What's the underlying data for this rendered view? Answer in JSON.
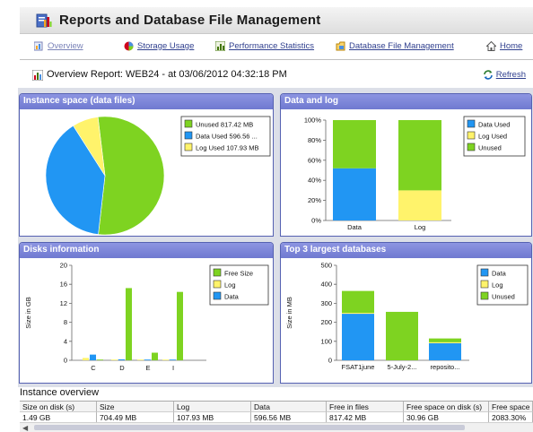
{
  "window": {
    "title": "Reports and Database File Management"
  },
  "nav": {
    "items": [
      {
        "label": "Overview",
        "icon": "overview-icon",
        "active": true
      },
      {
        "label": "Storage Usage",
        "icon": "storage-icon"
      },
      {
        "label": "Performance Statistics",
        "icon": "performance-icon"
      },
      {
        "label": "Database File Management",
        "icon": "database-file-icon"
      },
      {
        "label": "Home",
        "icon": "home-icon"
      }
    ]
  },
  "report": {
    "title": "Overview Report: WEB24 - at 03/06/2012 04:32:18 PM",
    "refresh_label": "Refresh"
  },
  "colors": {
    "green": "#7ed321",
    "blue": "#2196f3",
    "yellow": "#fff36b",
    "header": "#7982d6"
  },
  "panels": {
    "instance_space": {
      "title": "Instance space (data files)"
    },
    "data_and_log": {
      "title": "Data and log"
    },
    "disks": {
      "title": "Disks information"
    },
    "top3": {
      "title": "Top 3 largest databases"
    }
  },
  "chart_data": [
    {
      "type": "pie",
      "title": "Instance space (data files)",
      "labels": [
        "Unused 817.42 MB",
        "Data Used 596.56 ...",
        "Log Used 107.93 MB"
      ],
      "values": [
        817.42,
        596.56,
        107.93
      ],
      "colors": [
        "#7ed321",
        "#2196f3",
        "#fff36b"
      ],
      "legend": "top-right"
    },
    {
      "type": "bar",
      "stacked": true,
      "title": "Data and log",
      "categories": [
        "Data",
        "Log"
      ],
      "series": [
        {
          "name": "Data Used",
          "values": [
            52,
            0
          ],
          "color": "#2196f3"
        },
        {
          "name": "Log Used",
          "values": [
            0,
            30
          ],
          "color": "#fff36b"
        },
        {
          "name": "Unused",
          "values": [
            48,
            70
          ],
          "color": "#7ed321"
        }
      ],
      "yticks": [
        "0%",
        "20%",
        "40%",
        "60%",
        "80%",
        "100%"
      ],
      "ylim": [
        0,
        100
      ],
      "legend": "top-right"
    },
    {
      "type": "bar",
      "title": "Disks information",
      "ylabel": "Size in GB",
      "categories": [
        "C",
        "D",
        "E",
        "I"
      ],
      "series": [
        {
          "name": "Free Size",
          "values": [
            0.1,
            15.2,
            1.6,
            14.4
          ],
          "color": "#7ed321"
        },
        {
          "name": "Log",
          "values": [
            0.5,
            0.1,
            0.1,
            0.1
          ],
          "color": "#fff36b"
        },
        {
          "name": "Data",
          "values": [
            1.2,
            0.2,
            0.1,
            0.1
          ],
          "color": "#2196f3"
        }
      ],
      "yticks": [
        "0",
        "4",
        "8",
        "12",
        "16",
        "20"
      ],
      "ylim": [
        0,
        20
      ],
      "legend": "top-right"
    },
    {
      "type": "bar",
      "stacked": true,
      "title": "Top 3 largest databases",
      "ylabel": "Size in MB",
      "categories": [
        "FSAT1june",
        "5-July-2...",
        "reposito..."
      ],
      "series": [
        {
          "name": "Data",
          "values": [
            245,
            0,
            90
          ],
          "color": "#2196f3"
        },
        {
          "name": "Log",
          "values": [
            5,
            0,
            5
          ],
          "color": "#fff36b"
        },
        {
          "name": "Unused",
          "values": [
            115,
            255,
            20
          ],
          "color": "#7ed321"
        }
      ],
      "yticks": [
        "0",
        "100",
        "200",
        "300",
        "400",
        "500"
      ],
      "ylim": [
        0,
        500
      ],
      "legend": "top-right"
    }
  ],
  "instance_overview": {
    "label": "Instance overview",
    "columns": [
      "Size on disk (s)",
      "Size",
      "Log",
      "Data",
      "Free in files",
      "Free space on disk (s)",
      "Free space"
    ],
    "rows": [
      [
        "1.49 GB",
        "704.49 MB",
        "107.93 MB",
        "596.56 MB",
        "817.42 MB",
        "30.96 GB",
        "2083.30%"
      ]
    ]
  }
}
